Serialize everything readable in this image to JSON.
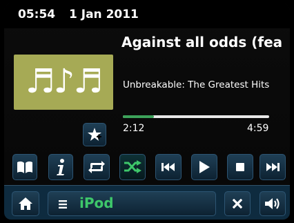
{
  "status": {
    "time": "05:54",
    "date": "1 Jan 2011"
  },
  "track": {
    "title": "Against all odds (fea",
    "album": "Unbreakable: The Greatest Hits",
    "elapsed": "2:12",
    "duration": "4:59",
    "progress": 0.21
  },
  "album_art": {
    "glyphs": "♬♪♬",
    "color": "#a6aa55"
  },
  "colors": {
    "accent": "#3ec76a",
    "button_bg": "#163246",
    "button_border": "#2d5573"
  },
  "controls": {
    "icons": [
      "book-icon",
      "info-icon",
      "repeat-icon",
      "shuffle-icon",
      "previous-icon",
      "play-icon",
      "stop-icon",
      "next-icon"
    ],
    "shuffle_active": true
  },
  "bottom": {
    "source_label": "iPod"
  }
}
